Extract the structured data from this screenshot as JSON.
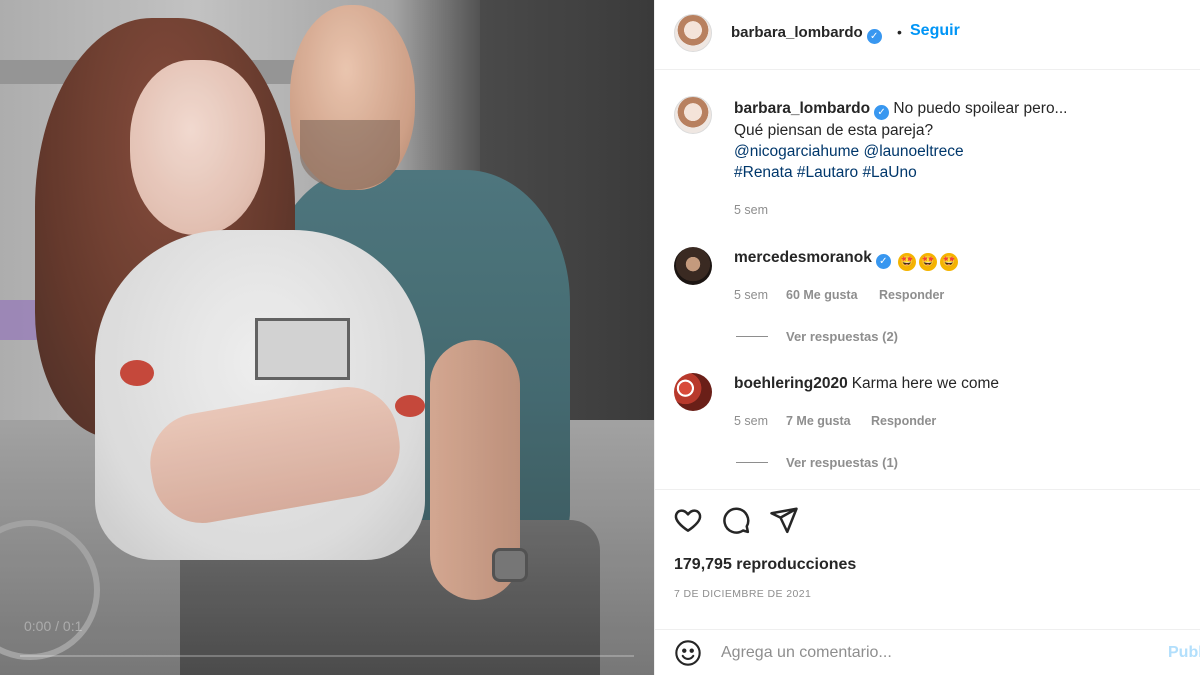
{
  "post": {
    "author": "barbara_lombardo",
    "follow_label": "Seguir",
    "separator": "•"
  },
  "caption": {
    "line1": "No puedo spoilear pero...",
    "line2": "Qué piensan de esta pareja?",
    "mention1": "@nicogarciahume",
    "mention2": "@launoeltrece",
    "hashtag1": "#Renata",
    "hashtag2": "#Lautaro",
    "hashtag3": "#LaUno",
    "time": "5 sem"
  },
  "comments": [
    {
      "user": "mercedesmoranok",
      "text": "",
      "emojis": [
        "🤩",
        "🤩",
        "🤩"
      ],
      "time": "5 sem",
      "likes": "60 Me gusta",
      "reply_label": "Responder",
      "view_replies": "Ver respuestas (2)"
    },
    {
      "user": "boehlering2020",
      "text": "Karma here we come",
      "time": "5 sem",
      "likes": "7 Me gusta",
      "reply_label": "Responder",
      "view_replies": "Ver respuestas (1)"
    }
  ],
  "stats": {
    "views": "179,795 reproducciones",
    "date": "7 DE DICIEMBRE DE 2021"
  },
  "comment_box": {
    "placeholder": "Agrega un comentario...",
    "publish_label": "Publicar"
  },
  "video": {
    "time": "0:00 / 0:1"
  },
  "colors": {
    "accent": "#0095f6",
    "verified": "#3897f0",
    "muted": "#8e8e8e"
  },
  "icons": [
    "heart-icon",
    "comment-icon",
    "share-icon",
    "emoji-icon",
    "verified-icon"
  ]
}
